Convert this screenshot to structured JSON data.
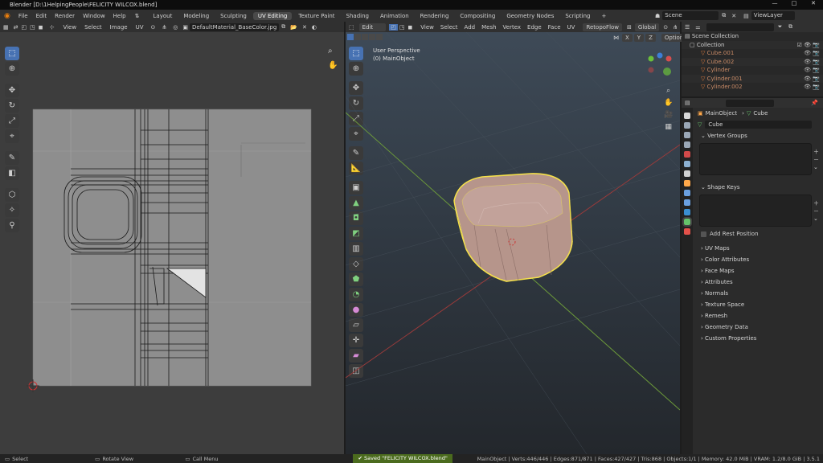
{
  "window": {
    "title": "Blender [D:\\1HelpingPeople\\FELICITY WILCOX.blend]",
    "controls": [
      "—",
      "□",
      "✕"
    ]
  },
  "menu": [
    "File",
    "Edit",
    "Render",
    "Window",
    "Help"
  ],
  "workspaces": [
    "Layout",
    "Modeling",
    "Sculpting",
    "UV Editing",
    "Texture Paint",
    "Shading",
    "Animation",
    "Rendering",
    "Compositing",
    "Geometry Nodes",
    "Scripting",
    "+"
  ],
  "active_workspace": "UV Editing",
  "scene": {
    "scene_name": "Scene",
    "view_layer": "ViewLayer"
  },
  "uv_editor": {
    "menus": [
      "View",
      "Select",
      "Image",
      "UV"
    ],
    "image_name": "DefaultMaterial_BaseColor.jpg",
    "tools": [
      "select-box-icon",
      "cursor-icon",
      "move-icon",
      "rotate-icon",
      "scale-icon",
      "transform-icon",
      "annotate-icon",
      "grab-icon",
      "relax-icon",
      "pinch-icon",
      "rip-icon"
    ]
  },
  "viewport": {
    "mode": "Edit Mode",
    "menus": [
      "View",
      "Select",
      "Add",
      "Mesh",
      "Vertex",
      "Edge",
      "Face",
      "UV"
    ],
    "addon": "RetopoFlow",
    "orientation": "Global",
    "axes": [
      "X",
      "Y",
      "Z"
    ],
    "options_label": "Options",
    "perspective": "User Perspective",
    "object_label": "(0) MainObject",
    "tools": [
      "select-box-icon",
      "cursor-icon",
      "move-icon",
      "rotate-icon",
      "scale-icon",
      "transform-icon",
      "annotate-icon",
      "measure-icon",
      "add-cube-icon",
      "extrude-icon",
      "inset-icon",
      "bevel-icon",
      "loopcut-icon",
      "knife-icon",
      "polybuild-icon",
      "spin-icon",
      "smooth-icon",
      "edge-slide-icon",
      "shrink-icon",
      "shear-icon",
      "rip-region-icon"
    ]
  },
  "outliner": {
    "search_placeholder": "",
    "root": "Scene Collection",
    "collection": "Collection",
    "items": [
      "Cube.001",
      "Cube.002",
      "Cylinder",
      "Cylinder.001",
      "Cylinder.002"
    ]
  },
  "properties": {
    "breadcrumb_object": "MainObject",
    "breadcrumb_data": "Cube",
    "data_name": "Cube",
    "panels_open": [
      "Vertex Groups",
      "Shape Keys"
    ],
    "add_rest_position": "Add Rest Position",
    "panels_closed": [
      "UV Maps",
      "Color Attributes",
      "Face Maps",
      "Attributes",
      "Normals",
      "Texture Space",
      "Remesh",
      "Geometry Data",
      "Custom Properties"
    ],
    "tab_colors": [
      "#d8d8d8",
      "#c7602d",
      "#9aa7b6",
      "#ffa84a",
      "#d34a4a",
      "#8db0d0",
      "#d2823a",
      "#6aa0e0",
      "#3a8ed0",
      "#65c36a",
      "#e3514a"
    ]
  },
  "status": {
    "left_hints": [
      "Select",
      "Rotate View",
      "Call Menu"
    ],
    "message": "Saved \"FELICITY WILCOX.blend\"",
    "stats": "MainObject | Verts:446/446 | Edges:871/871 | Faces:427/427 | Tris:868 | Objects:1/1 | Memory: 42.0 MiB | VRAM: 1.2/8.0 GiB | 3.5.1"
  }
}
